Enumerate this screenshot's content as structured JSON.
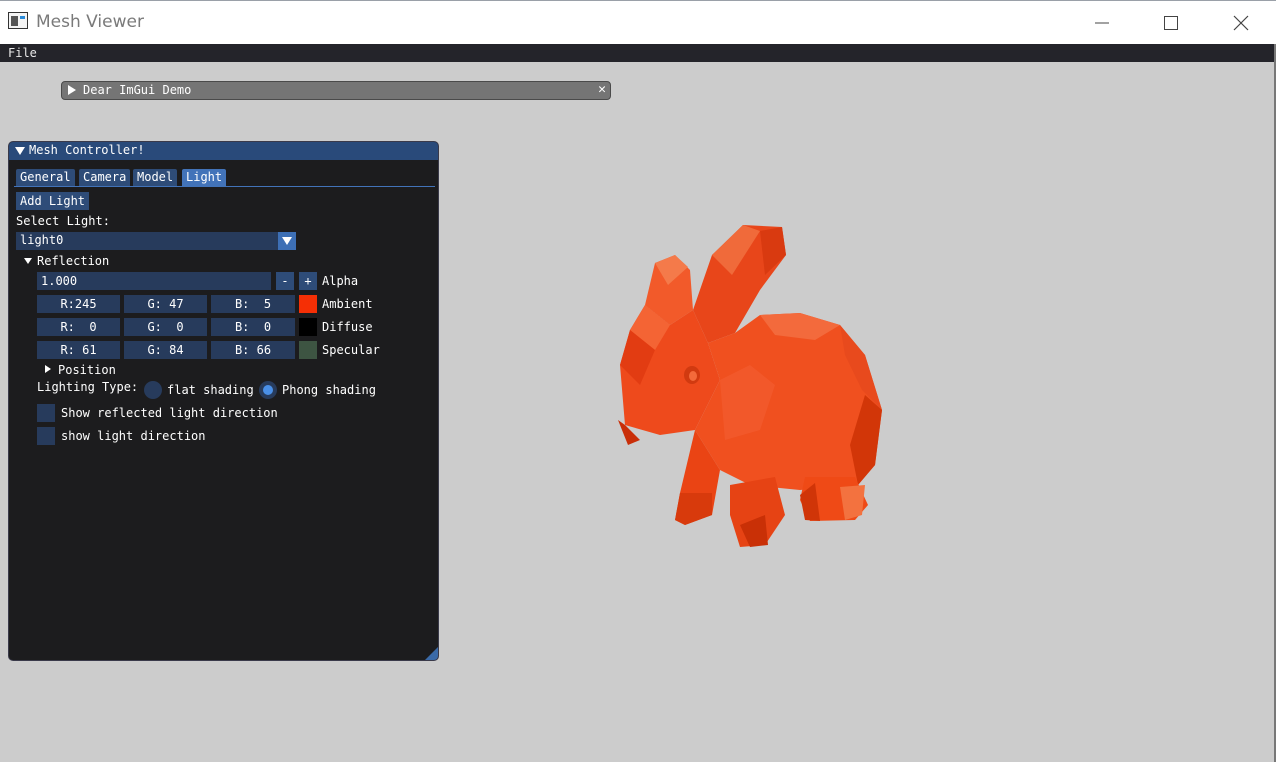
{
  "window": {
    "title": "Mesh Viewer"
  },
  "menubar": {
    "file": "File"
  },
  "demo_window": {
    "title": "Dear ImGui Demo",
    "close": "✕"
  },
  "panel": {
    "title": "Mesh Controller!",
    "tabs": [
      {
        "label": "General",
        "active": false
      },
      {
        "label": "Camera",
        "active": false
      },
      {
        "label": "Model",
        "active": false
      },
      {
        "label": "Light",
        "active": true
      }
    ],
    "add_light": "Add Light",
    "select_light_label": "Select Light:",
    "selected_light": "light0",
    "reflection": {
      "header": "Reflection",
      "alpha": {
        "value": "1.000",
        "minus": "-",
        "plus": "+",
        "label": "Alpha"
      },
      "ambient": {
        "r": "R:245",
        "g": "G: 47",
        "b": "B:  5",
        "label": "Ambient",
        "color": "#f52f05"
      },
      "diffuse": {
        "r": "R:  0",
        "g": "G:  0",
        "b": "B:  0",
        "label": "Diffuse",
        "color": "#000000"
      },
      "specular": {
        "r": "R: 61",
        "g": "G: 84",
        "b": "B: 66",
        "label": "Specular",
        "color": "#3d5442"
      }
    },
    "position_header": "Position",
    "lighting_type": {
      "label": "Lighting Type:",
      "options": [
        "flat shading",
        "Phong shading"
      ],
      "selected": "Phong shading"
    },
    "checkboxes": [
      {
        "label": "Show reflected light direction",
        "checked": false
      },
      {
        "label": "show light direction",
        "checked": false
      }
    ]
  },
  "viewport": {
    "background": "#cccccc",
    "model_color": "#f24a22"
  }
}
